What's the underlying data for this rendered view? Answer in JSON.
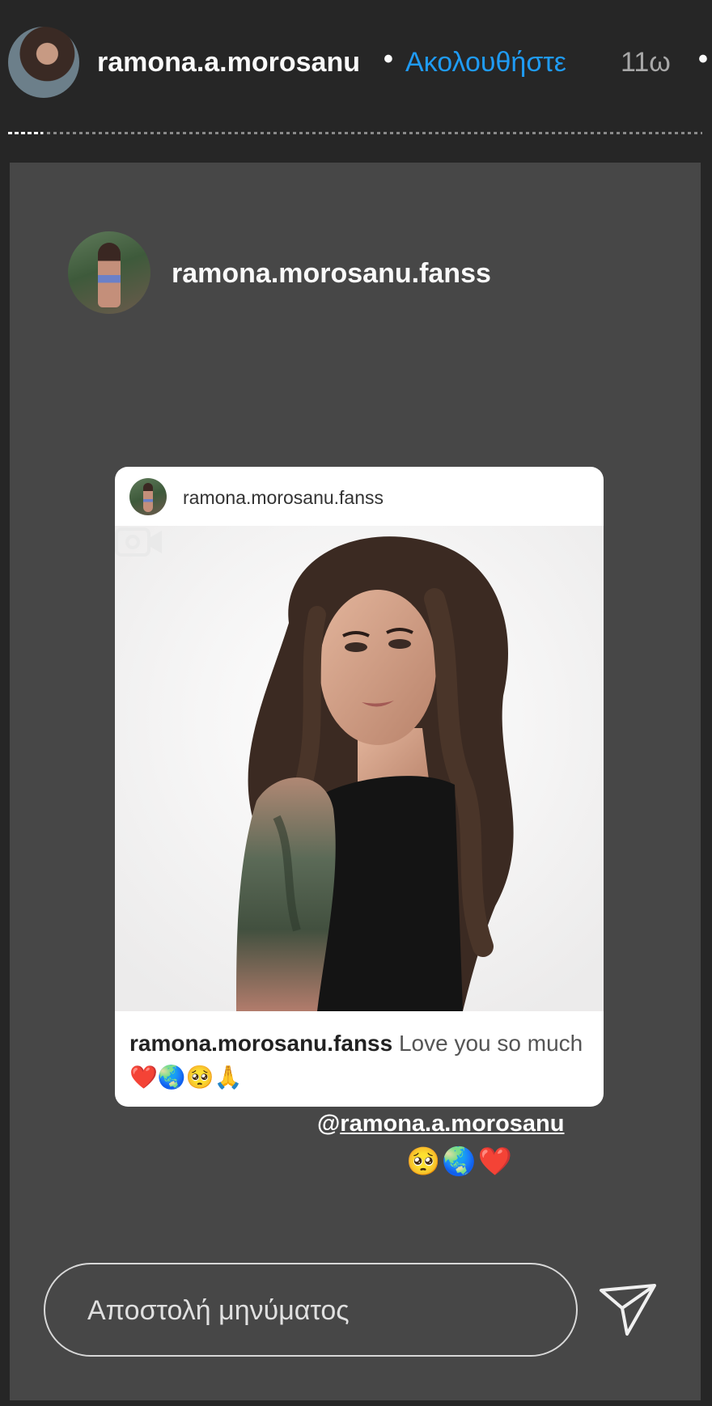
{
  "header": {
    "username": "ramona.a.morosanu",
    "separator": "•",
    "follow_label": "Ακολουθήστε",
    "time_ago": "11ω",
    "more": "•"
  },
  "story": {
    "progress_fraction": 0.05,
    "poster_name": "ramona.morosanu.fanss",
    "shared_post": {
      "username": "ramona.morosanu.fanss",
      "caption_user": "ramona.morosanu.fanss",
      "caption_text": " Love you so much ❤️🌏🥺🙏"
    },
    "mention": {
      "at": "@",
      "handle": "ramona.a.morosanu",
      "emojis": "🥺🌏❤️"
    }
  },
  "reply": {
    "placeholder": "Αποστολή μηνύματος"
  },
  "icons": {
    "send": "send-icon",
    "video": "video-camera-icon"
  },
  "colors": {
    "background": "#262626",
    "panel": "#474747",
    "follow_blue": "#1f9bf5"
  }
}
